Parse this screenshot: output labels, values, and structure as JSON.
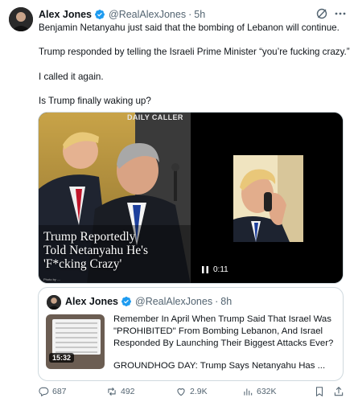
{
  "author": {
    "name": "Alex Jones",
    "handle": "@RealAlexJones",
    "separator": "·",
    "time": "5h",
    "verified_icon": "verified-badge-icon",
    "verified_color": "#1d9bf0"
  },
  "tweet": {
    "lines": [
      "Benjamin Netanyahu just said that the bombing of Lebanon will continue.",
      "Trump responded by telling the Israeli Prime Minister “you’re fucking crazy.”",
      "I called it again.",
      "Is Trump finally waking up?"
    ]
  },
  "media": {
    "image": {
      "watermark": "DAILY CALLER",
      "headline": "Trump Reportedly\nTold Netanyahu He's\n'F*cking Crazy'",
      "credit": "Photo by ...."
    },
    "video": {
      "state_icon": "pause-icon",
      "timestamp": "0:11"
    }
  },
  "quote": {
    "name": "Alex Jones",
    "handle": "@RealAlexJones",
    "separator": "·",
    "time": "8h",
    "video_duration": "15:32",
    "lines": [
      "Remember In April When Trump Said That Israel Was",
      "\"PROHIBITED\" From Bombing Lebanon, And Israel",
      "Responded By Launching Their Biggest Attacks Ever?",
      "GROUNDHOG DAY: Trump Says Netanyahu Has ..."
    ]
  },
  "actions": {
    "replies": "687",
    "reposts": "492",
    "likes": "2.9K",
    "views": "632K"
  },
  "colors": {
    "text": "#0f1419",
    "secondary": "#536471",
    "border": "#cfd9de",
    "accent": "#1d9bf0"
  }
}
